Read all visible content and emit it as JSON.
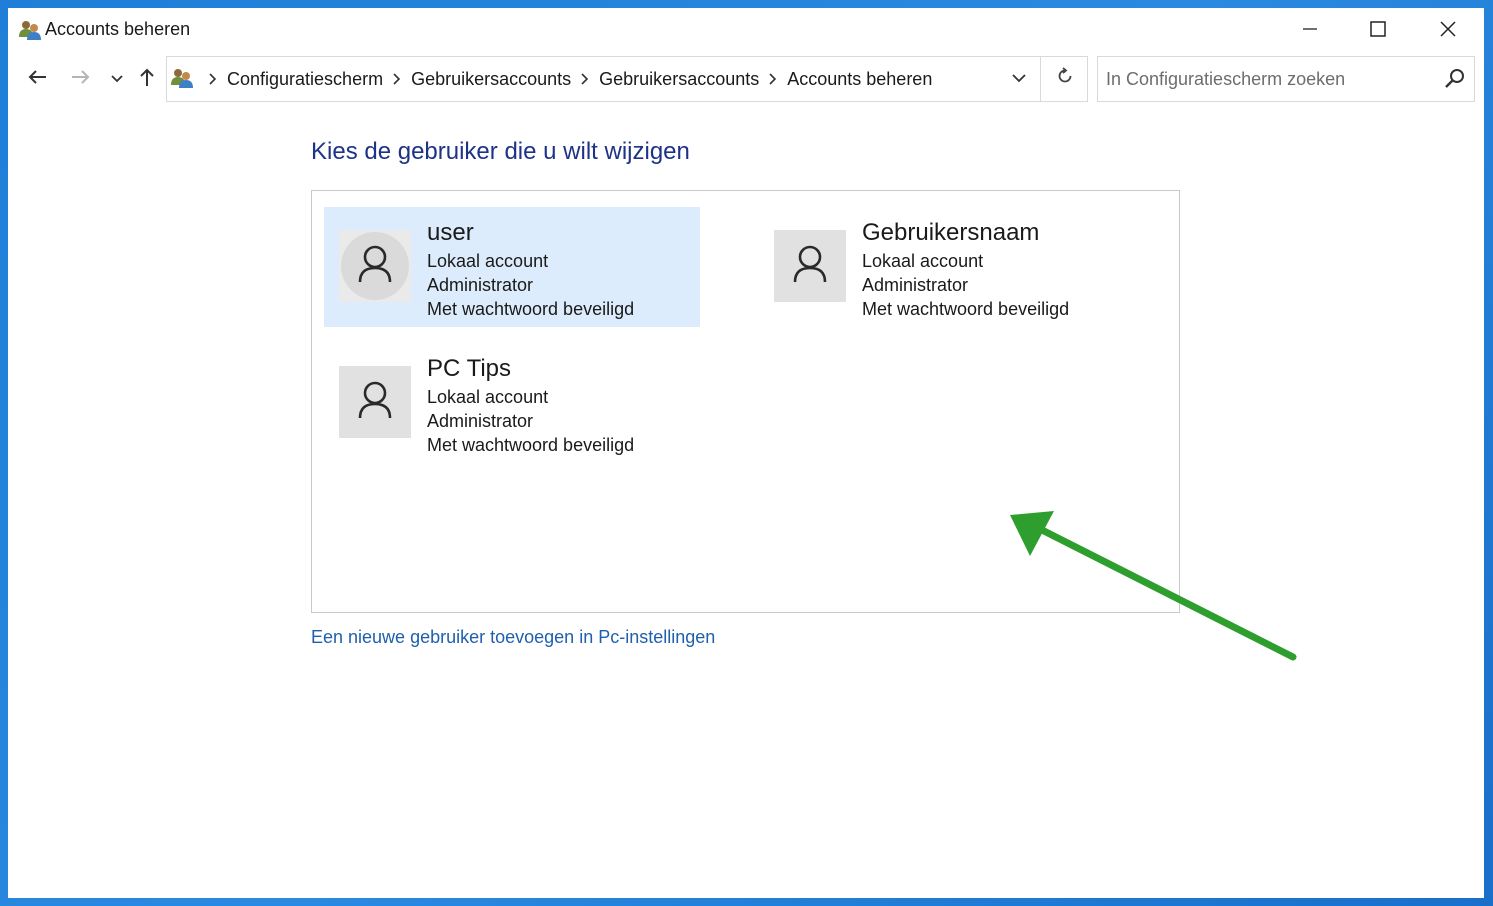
{
  "window": {
    "title": "Accounts beheren",
    "icon": "users-icon",
    "controls": [
      "minimize-icon",
      "maximize-icon",
      "close-icon"
    ]
  },
  "navigation": {
    "back_icon": "arrow-left-icon",
    "forward_icon": "arrow-right-icon",
    "recent_icon": "chevron-down-icon",
    "up_icon": "arrow-up-icon",
    "breadcrumbs": [
      "Configuratiescherm",
      "Gebruikersaccounts",
      "Gebruikersaccounts",
      "Accounts beheren"
    ],
    "separator_icon": "chevron-right-icon",
    "refresh_icon": "refresh-icon"
  },
  "search": {
    "placeholder": "In Configuratiescherm zoeken",
    "value": "",
    "icon": "search-icon"
  },
  "main": {
    "heading": "Kies de gebruiker die u wilt wijzigen",
    "accounts": [
      {
        "name": "user",
        "type": "Lokaal account",
        "role": "Administrator",
        "protection": "Met wachtwoord beveiligd",
        "selected": true
      },
      {
        "name": "Gebruikersnaam",
        "type": "Lokaal account",
        "role": "Administrator",
        "protection": "Met wachtwoord beveiligd",
        "selected": false
      },
      {
        "name": "PC Tips",
        "type": "Lokaal account",
        "role": "Administrator",
        "protection": "Met wachtwoord beveiligd",
        "selected": false
      }
    ],
    "add_user_link": "Een nieuwe gebruiker toevoegen in Pc-instellingen"
  },
  "annotation": {
    "arrow_color": "#2e9e2e"
  },
  "colors": {
    "heading": "#1e3287",
    "link": "#1f5fae",
    "selected_card": "#dcecfc",
    "desktop": "#1f7fd8"
  }
}
